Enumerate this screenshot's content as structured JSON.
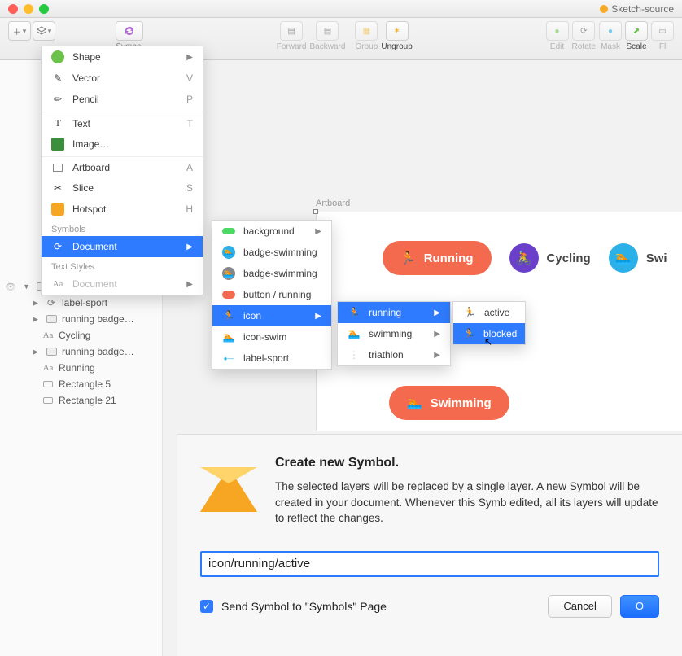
{
  "window": {
    "title": "Sketch-source"
  },
  "toolbar": {
    "symbol_label": "Symbol",
    "forward": "Forward",
    "backward": "Backward",
    "group": "Group",
    "ungroup": "Ungroup",
    "edit": "Edit",
    "rotate": "Rotate",
    "mask": "Mask",
    "scale": "Scale",
    "flatten": "Fl"
  },
  "insert_menu": {
    "shape": "Shape",
    "vector": "Vector",
    "vector_sc": "V",
    "pencil": "Pencil",
    "pencil_sc": "P",
    "text": "Text",
    "text_sc": "T",
    "image": "Image…",
    "artboard": "Artboard",
    "artboard_sc": "A",
    "slice": "Slice",
    "slice_sc": "S",
    "hotspot": "Hotspot",
    "hotspot_sc": "H",
    "symbols_header": "Symbols",
    "document": "Document",
    "text_styles_header": "Text Styles",
    "document2": "Document"
  },
  "submenu2": {
    "background": "background",
    "badge_swimming1": "badge-swimming",
    "badge_swimming2": "badge-swimming",
    "button_running": "button / running",
    "icon": "icon",
    "icon_swim": "icon-swim",
    "label_sport": "label-sport"
  },
  "submenu3": {
    "running": "running",
    "swimming": "swimming",
    "triathlon": "triathlon"
  },
  "submenu4": {
    "active": "active",
    "blocked": "blocked"
  },
  "layers": {
    "running_badge1": "running badge…",
    "label_sport": "label-sport",
    "running_badge2": "running badge…",
    "cycling": "Cycling",
    "running_badge3": "running badge…",
    "running": "Running",
    "rect5": "Rectangle 5",
    "rect21": "Rectangle 21"
  },
  "canvas": {
    "artboard_label": "Artboard",
    "running": "Running",
    "cycling": "Cycling",
    "swimming_top": "Swi",
    "swimming": "Swimming"
  },
  "dialog": {
    "title": "Create new Symbol.",
    "body": "The selected layers will be replaced by a single layer. A new Symbol will be created in your document. Whenever this Symb edited, all its layers will update to reflect the changes.",
    "input_value": "icon/running/active",
    "checkbox_label": "Send Symbol to \"Symbols\" Page",
    "cancel": "Cancel",
    "ok": "O"
  }
}
